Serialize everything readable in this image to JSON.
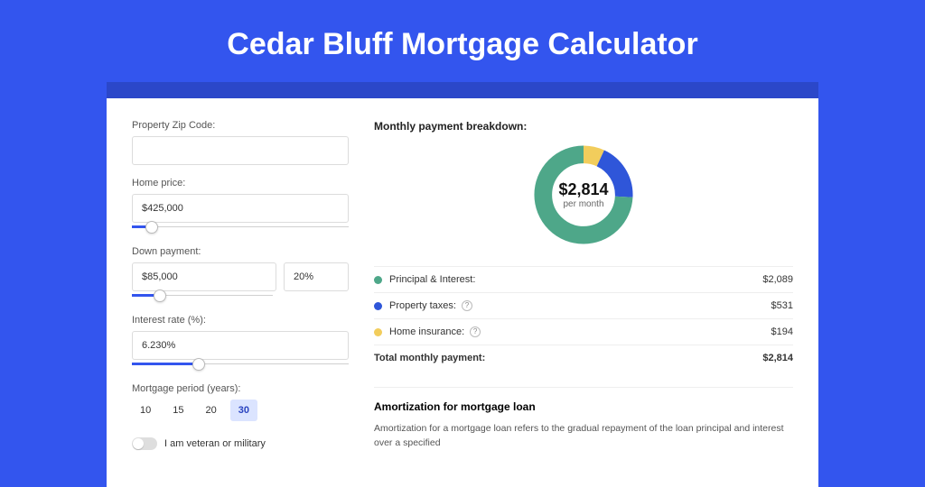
{
  "title": "Cedar Bluff Mortgage Calculator",
  "form": {
    "zip_label": "Property Zip Code:",
    "zip_value": "",
    "home_price_label": "Home price:",
    "home_price_value": "$425,000",
    "home_price_slider_pct": 9,
    "down_payment_label": "Down payment:",
    "down_payment_value": "$85,000",
    "down_payment_pct_value": "20%",
    "down_payment_slider_pct": 20,
    "interest_rate_label": "Interest rate (%):",
    "interest_rate_value": "6.230%",
    "interest_rate_slider_pct": 31,
    "mortgage_period_label": "Mortgage period (years):",
    "mortgage_periods": [
      "10",
      "15",
      "20",
      "30"
    ],
    "mortgage_period_selected": "30",
    "veteran_label": "I am veteran or military",
    "veteran": false
  },
  "breakdown": {
    "heading": "Monthly payment breakdown:",
    "center_amount": "$2,814",
    "center_label": "per month",
    "items": [
      {
        "label": "Principal & Interest:",
        "value": "$2,089",
        "numeric": 2089,
        "color": "#4ea789",
        "help": false
      },
      {
        "label": "Property taxes:",
        "value": "$531",
        "numeric": 531,
        "color": "#2f56d9",
        "help": true
      },
      {
        "label": "Home insurance:",
        "value": "$194",
        "numeric": 194,
        "color": "#f2cd5c",
        "help": true
      }
    ],
    "total_label": "Total monthly payment:",
    "total_value": "$2,814",
    "total_numeric": 2814
  },
  "chart_data": {
    "type": "pie",
    "title": "Monthly payment breakdown",
    "series": [
      {
        "name": "Principal & Interest",
        "value": 2089,
        "color": "#4ea789"
      },
      {
        "name": "Property taxes",
        "value": 531,
        "color": "#2f56d9"
      },
      {
        "name": "Home insurance",
        "value": 194,
        "color": "#f2cd5c"
      }
    ],
    "total": 2814,
    "center_value": "$2,814",
    "center_label": "per month"
  },
  "amortization": {
    "heading": "Amortization for mortgage loan",
    "text": "Amortization for a mortgage loan refers to the gradual repayment of the loan principal and interest over a specified"
  }
}
